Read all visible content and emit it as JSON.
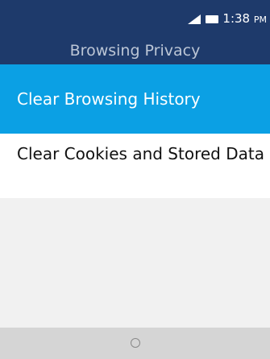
{
  "status_bar": {
    "time": "1:38",
    "ampm": "PM"
  },
  "header": {
    "title": "Browsing Privacy"
  },
  "menu": {
    "items": [
      {
        "label": "Clear Browsing History",
        "selected": true
      },
      {
        "label": "Clear Cookies and Stored Data",
        "selected": false
      }
    ]
  },
  "icons": {
    "signal": "signal-icon",
    "battery": "battery-icon",
    "home": "home-icon"
  },
  "colors": {
    "header_bg": "#1e3a6b",
    "selected_bg": "#0ba0e4"
  }
}
